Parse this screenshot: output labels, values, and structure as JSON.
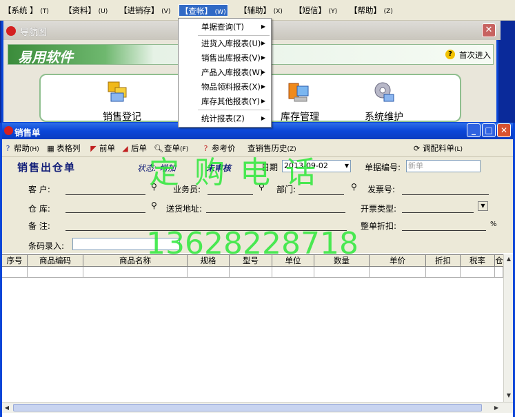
{
  "menubar": {
    "items": [
      {
        "label": "【系统 】",
        "acc": "(T)"
      },
      {
        "label": "【资料】",
        "acc": "(U)"
      },
      {
        "label": "【进销存】",
        "acc": "(V)"
      },
      {
        "label": "【查帐】",
        "acc": "(W)"
      },
      {
        "label": "【辅助】",
        "acc": "(X)"
      },
      {
        "label": "【短信】",
        "acc": "(Y)"
      },
      {
        "label": "【帮助】",
        "acc": "(Z)"
      }
    ]
  },
  "dropdown": {
    "items": [
      {
        "label": "单据查询",
        "acc": "(T)",
        "arrow": "▶"
      },
      {
        "label": "进货入库报表",
        "acc": "(U)",
        "arrow": "▶"
      },
      {
        "label": "销售出库报表",
        "acc": "(V)",
        "arrow": "▶"
      },
      {
        "label": "产品入库报表",
        "acc": "(W)",
        "arrow": "▶"
      },
      {
        "label": "物品领料报表",
        "acc": "(X)",
        "arrow": "▶"
      },
      {
        "label": "库存其他报表",
        "acc": "(Y)",
        "arrow": "▶"
      },
      {
        "label": "统计报表",
        "acc": "(Z)",
        "arrow": "▶"
      }
    ]
  },
  "nav_window": {
    "title": "导航图",
    "logo_text": "易用",
    "brand": "易用软件",
    "first_entry": "首次进入",
    "tiles": [
      "销售登记",
      "库存管理",
      "系统维护"
    ]
  },
  "sale_window": {
    "title": "销售单",
    "logo_text": "易用"
  },
  "toolbar": {
    "help": "帮助",
    "help_acc": "(H)",
    "table_format": "表格列",
    "prev": "前单",
    "next": "后单",
    "lookup": "查单",
    "lookup_acc": "(F)",
    "ref_price": "参考价",
    "history": "查销售历史",
    "history_acc": "(Z)",
    "adjust": "调配料单",
    "adjust_acc": "(L)"
  },
  "form": {
    "title": "销售出仓单",
    "status_label": "状态:",
    "status_value": "增加",
    "audit_status": "未审核",
    "date_label": "日期",
    "date_value": "2013-09-02",
    "doc_no_label": "单据编号:",
    "doc_no_value": "新单",
    "customer_label": "客    户:",
    "salesman_label": "业务员:",
    "dept_label": "部门:",
    "invoice_no_label": "发票号:",
    "warehouse_label": "仓    库:",
    "address_label": "送货地址:",
    "invoice_type_label": "开票类型:",
    "remark_label": "备    注:",
    "discount_label": "整单折扣:",
    "percent": "%",
    "barcode_label": "条码录入:"
  },
  "grid": {
    "columns": [
      "序号",
      "商品编码",
      "商品名称",
      "规格",
      "型号",
      "单位",
      "数量",
      "单价",
      "折扣",
      "税率",
      "仓"
    ]
  },
  "watermark": {
    "line1": "定 购 电 话",
    "line2": "13628228718"
  },
  "colors": {
    "title_bar": "#0a46d8",
    "menu_bg": "#ece9d8",
    "form_title": "#16227a",
    "watermark": "#2de83a"
  }
}
